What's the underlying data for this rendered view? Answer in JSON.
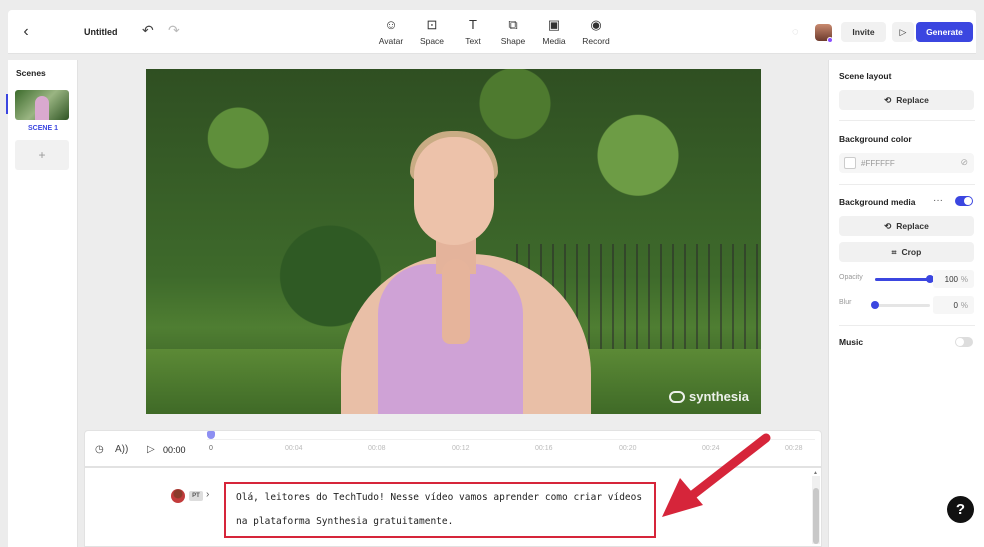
{
  "topbar": {
    "back_icon": "‹",
    "title": "Untitled",
    "undo_icon": "↶",
    "redo_icon": "↷",
    "tools": [
      {
        "label": "Avatar",
        "icon": "☺"
      },
      {
        "label": "Space",
        "icon": "⊡"
      },
      {
        "label": "Text",
        "icon": "T"
      },
      {
        "label": "Shape",
        "icon": "⧉"
      },
      {
        "label": "Media",
        "icon": "▣"
      },
      {
        "label": "Record",
        "icon": "◉"
      }
    ],
    "invite_label": "Invite",
    "generate_label": "Generate"
  },
  "scenes": {
    "title": "Scenes",
    "items": [
      {
        "label": "SCENE 1"
      }
    ],
    "add_label": "+"
  },
  "video": {
    "watermark": "synthesia"
  },
  "panel": {
    "scene_layout_title": "Scene layout",
    "replace_label": "Replace",
    "background_color_title": "Background color",
    "background_color_value": "#FFFFFF",
    "background_media_title": "Background media",
    "background_media_enabled": true,
    "crop_label": "Crop",
    "opacity": {
      "label": "Opacity",
      "value": "100",
      "unit": "%",
      "fraction": 1.0
    },
    "blur": {
      "label": "Blur",
      "value": "0",
      "unit": "%",
      "fraction": 0.0
    },
    "music_title": "Music",
    "music_enabled": false
  },
  "timeline": {
    "current_time": "00:00",
    "ticks": [
      "0",
      "00:04",
      "00:08",
      "00:12",
      "00:16",
      "00:20",
      "00:24",
      "00:28"
    ]
  },
  "script": {
    "language": "PT",
    "line1": "Olá, leitores do TechTudo! Nesse vídeo vamos aprender como criar vídeos",
    "line2": "na plataforma Synthesia gratuitamente."
  },
  "help_label": "?",
  "colors": {
    "accent": "#3b46e0",
    "annotation": "#d6253a"
  }
}
